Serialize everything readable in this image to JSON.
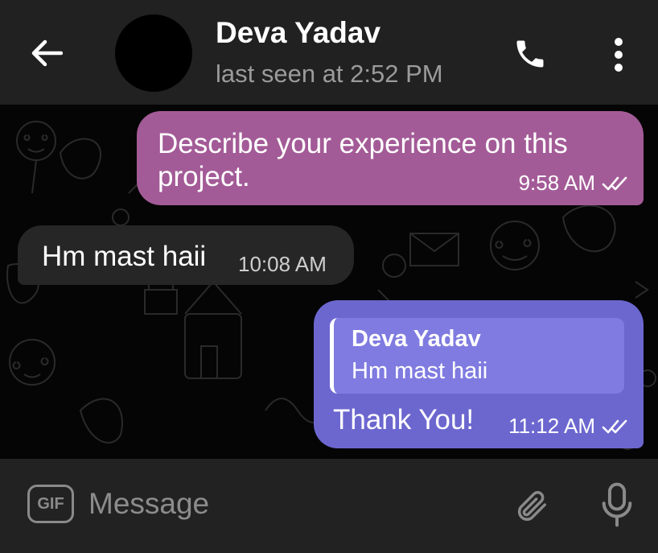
{
  "header": {
    "contact_name": "Deva Yadav",
    "status": "last seen at 2:52 PM",
    "icons": {
      "back": "arrow-left-icon",
      "call": "phone-icon",
      "menu": "more-vertical-icon"
    }
  },
  "messages": [
    {
      "direction": "outgoing",
      "text": "Describe your experience on this project.",
      "time": "9:58 AM",
      "status": "read",
      "color": "#a35b97"
    },
    {
      "direction": "incoming",
      "text": "Hm mast haii",
      "time": "10:08 AM",
      "color": "#262626"
    },
    {
      "direction": "outgoing",
      "reply_to": {
        "name": "Deva Yadav",
        "text": "Hm mast haii"
      },
      "text": "Thank You!",
      "time": "11:12 AM",
      "status": "read",
      "color": "#6c67cf"
    }
  ],
  "composer": {
    "gif_label": "GIF",
    "placeholder": "Message",
    "icons": {
      "attach": "paperclip-icon",
      "mic": "microphone-icon"
    }
  },
  "colors": {
    "header_bg": "#212121",
    "chat_bg": "#050505",
    "composer_bg": "#222222"
  }
}
